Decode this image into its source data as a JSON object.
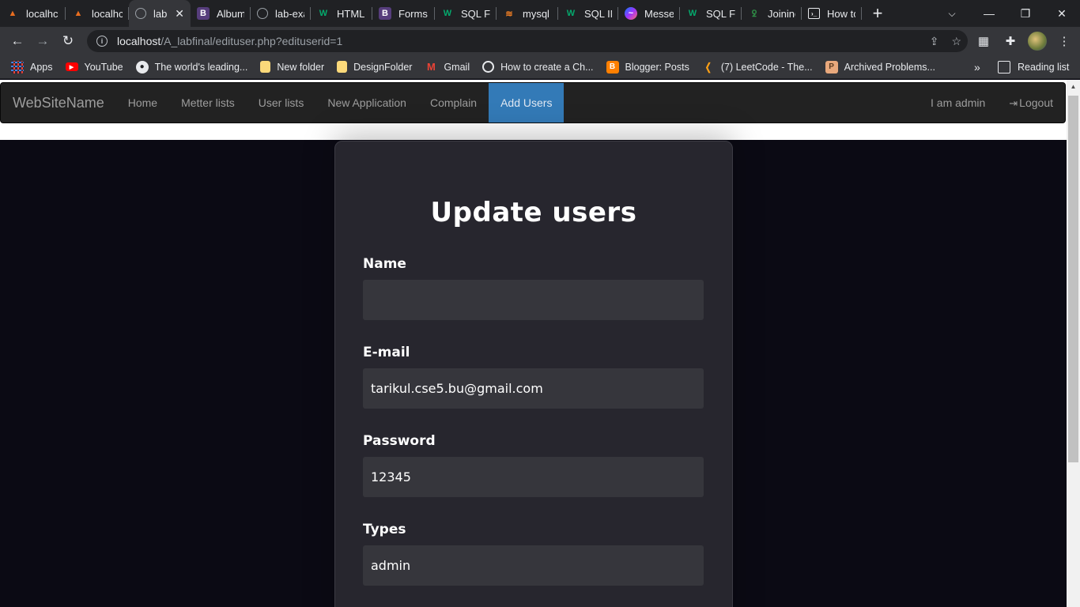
{
  "browser": {
    "tabs": [
      {
        "title": "localhc",
        "icon": "xampp-icon",
        "color": "#e86d1f"
      },
      {
        "title": "localhc",
        "icon": "xampp-icon",
        "color": "#e86d1f"
      },
      {
        "title": "lab",
        "icon": "globe-icon",
        "color": "#9aa0a6",
        "active": true
      },
      {
        "title": "Album",
        "icon": "bootstrap-icon",
        "color": "#563d7c"
      },
      {
        "title": "lab-exa",
        "icon": "globe-icon",
        "color": "#9aa0a6"
      },
      {
        "title": "HTML",
        "icon": "w3schools-icon",
        "color": "#04aa6d"
      },
      {
        "title": "Forms",
        "icon": "bootstrap-icon",
        "color": "#563d7c"
      },
      {
        "title": "SQL FC",
        "icon": "w3schools-icon",
        "color": "#04aa6d"
      },
      {
        "title": "mysql",
        "icon": "stackoverflow-icon",
        "color": "#f48024"
      },
      {
        "title": "SQL IN",
        "icon": "w3schools-icon",
        "color": "#04aa6d"
      },
      {
        "title": "Messe",
        "icon": "messenger-icon",
        "color": "#a033ff"
      },
      {
        "title": "SQL FU",
        "icon": "w3schools-icon",
        "color": "#04aa6d"
      },
      {
        "title": "Joining",
        "icon": "geeksforgeeks-icon",
        "color": "#2f8d46"
      },
      {
        "title": "How tc",
        "icon": "terminal-icon",
        "color": "#e8eaed"
      }
    ],
    "url_host": "localhost",
    "url_path": "/A_labfinal/edituser.php?edituserid=1",
    "bookmarks": [
      {
        "label": "Apps",
        "icon": "apps-grid-icon",
        "color": "#4285f4"
      },
      {
        "label": "YouTube",
        "icon": "youtube-icon",
        "color": "#ff0000"
      },
      {
        "label": "The world's leading...",
        "icon": "github-icon",
        "color": "#e8eaed"
      },
      {
        "label": "New folder",
        "icon": "folder-icon",
        "color": "#fbd97a"
      },
      {
        "label": "DesignFolder",
        "icon": "folder-icon",
        "color": "#fbd97a"
      },
      {
        "label": "Gmail",
        "icon": "gmail-icon",
        "color": "#ea4335"
      },
      {
        "label": "How to create a Ch...",
        "icon": "chrome-web-icon",
        "color": "#e8eaed"
      },
      {
        "label": "Blogger: Posts",
        "icon": "blogger-icon",
        "color": "#ff8000"
      },
      {
        "label": "(7) LeetCode - The...",
        "icon": "leetcode-icon",
        "color": "#ffa116"
      },
      {
        "label": "Archived Problems...",
        "icon": "archive-icon",
        "color": "#e8a87c"
      }
    ],
    "bookmarks_more": "»",
    "reading_list": "Reading list"
  },
  "site": {
    "brand": "WebSiteName",
    "nav": [
      "Home",
      "Metter lists",
      "User lists",
      "New Application",
      "Complain",
      "Add Users"
    ],
    "active_nav": "Add Users",
    "user_label": "I am admin",
    "logout": "Logout"
  },
  "form": {
    "title": "Update users",
    "fields": [
      {
        "label": "Name",
        "value": ""
      },
      {
        "label": "E-mail",
        "value": "tarikul.cse5.bu@gmail.com"
      },
      {
        "label": "Password",
        "value": "12345"
      },
      {
        "label": "Types",
        "value": "admin"
      }
    ]
  }
}
